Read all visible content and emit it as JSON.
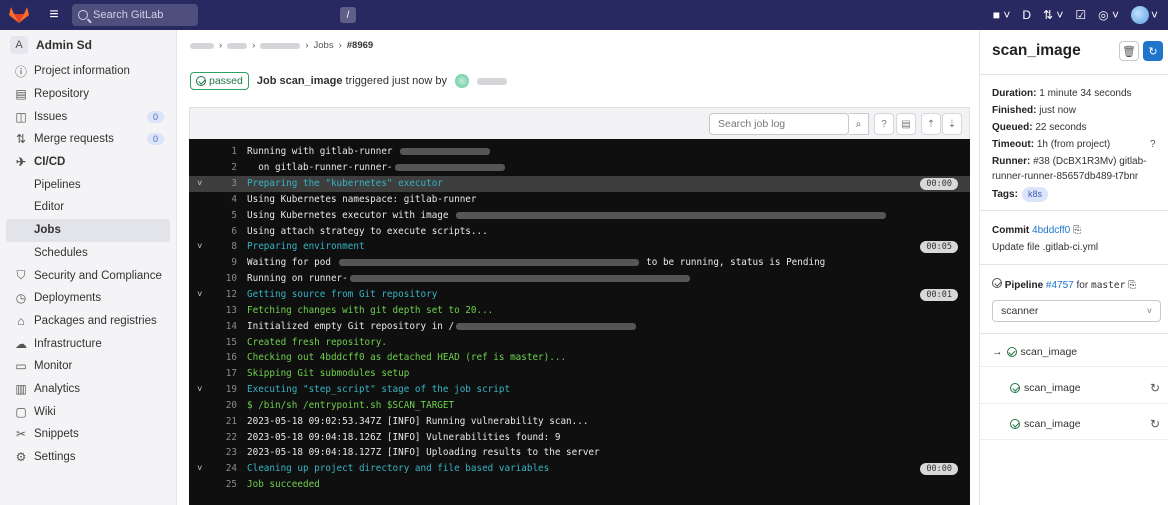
{
  "topbar": {
    "search_placeholder": "Search GitLab",
    "slash_key": "/"
  },
  "sidebar": {
    "project_letter": "A",
    "project_name": "Admin Sd",
    "items": [
      {
        "label": "Project information",
        "icon": "info-icon"
      },
      {
        "label": "Repository",
        "icon": "book-icon"
      },
      {
        "label": "Issues",
        "icon": "issues-icon",
        "count": "0"
      },
      {
        "label": "Merge requests",
        "icon": "merge-request-icon",
        "count": "0"
      },
      {
        "label": "CI/CD",
        "icon": "rocket-icon"
      },
      {
        "label": "Security and Compliance",
        "icon": "shield-icon"
      },
      {
        "label": "Deployments",
        "icon": "deployments-icon"
      },
      {
        "label": "Packages and registries",
        "icon": "package-icon"
      },
      {
        "label": "Infrastructure",
        "icon": "cloud-icon"
      },
      {
        "label": "Monitor",
        "icon": "monitor-icon"
      },
      {
        "label": "Analytics",
        "icon": "chart-icon"
      },
      {
        "label": "Wiki",
        "icon": "wiki-icon"
      },
      {
        "label": "Snippets",
        "icon": "snippet-icon"
      },
      {
        "label": "Settings",
        "icon": "gear-icon"
      }
    ],
    "cicd_sub": [
      "Pipelines",
      "Editor",
      "Jobs",
      "Schedules"
    ]
  },
  "breadcrumb": {
    "jobs": "Jobs",
    "current": "#8969"
  },
  "job_header": {
    "status": "passed",
    "prefix": "Job",
    "job_name": "scan_image",
    "suffix": "triggered just now by"
  },
  "log_toolbar": {
    "search_placeholder": "Search job log"
  },
  "log_lines": [
    {
      "n": "1",
      "text": "Running with gitlab-runner ",
      "cls": "",
      "blur": 90
    },
    {
      "n": "2",
      "text": "  on gitlab-runner-runner-",
      "cls": "",
      "blur": 110
    },
    {
      "n": "3",
      "text": "Preparing the \"kubernetes\" executor",
      "cls": "section hl",
      "chev": true,
      "dur": "00:00"
    },
    {
      "n": "4",
      "text": "Using Kubernetes namespace: gitlab-runner",
      "cls": ""
    },
    {
      "n": "5",
      "text": "Using Kubernetes executor with image ",
      "cls": "",
      "blur": 430
    },
    {
      "n": "6",
      "text": "Using attach strategy to execute scripts...",
      "cls": ""
    },
    {
      "n": "8",
      "text": "Preparing environment",
      "cls": "section",
      "chev": true,
      "dur": "00:05"
    },
    {
      "n": "9",
      "text": "Waiting for pod ",
      "cls": "",
      "blur": 300,
      "after": " to be running, status is Pending"
    },
    {
      "n": "10",
      "text": "Running on runner-",
      "cls": "",
      "blur": 340
    },
    {
      "n": "12",
      "text": "Getting source from Git repository",
      "cls": "section",
      "chev": true,
      "dur": "00:01"
    },
    {
      "n": "13",
      "text": "Fetching changes with git depth set to 20...",
      "cls": "green"
    },
    {
      "n": "14",
      "text": "Initialized empty Git repository in /",
      "cls": "",
      "blur": 180
    },
    {
      "n": "15",
      "text": "Created fresh repository.",
      "cls": "green"
    },
    {
      "n": "16",
      "text": "Checking out 4bddcff0 as detached HEAD (ref is master)...",
      "cls": "green"
    },
    {
      "n": "17",
      "text": "Skipping Git submodules setup",
      "cls": "green"
    },
    {
      "n": "19",
      "text": "Executing \"step_script\" stage of the job script",
      "cls": "section",
      "chev": true
    },
    {
      "n": "20",
      "text": "$ /bin/sh /entrypoint.sh $SCAN_TARGET",
      "cls": "green"
    },
    {
      "n": "21",
      "text": "2023-05-18 09:02:53.347Z [INFO] Running vulnerability scan...",
      "cls": ""
    },
    {
      "n": "22",
      "text": "2023-05-18 09:04:18.126Z [INFO] Vulnerabilities found: 9",
      "cls": ""
    },
    {
      "n": "23",
      "text": "2023-05-18 09:04:18.127Z [INFO] Uploading results to the server",
      "cls": ""
    },
    {
      "n": "24",
      "text": "Cleaning up project directory and file based variables",
      "cls": "section",
      "chev": true,
      "dur": "00:00"
    },
    {
      "n": "25",
      "text": "Job succeeded",
      "cls": "green"
    }
  ],
  "right_panel": {
    "title": "scan_image",
    "duration_label": "Duration:",
    "duration": "1 minute 34 seconds",
    "finished_label": "Finished:",
    "finished": "just now",
    "queued_label": "Queued:",
    "queued": "22 seconds",
    "timeout_label": "Timeout:",
    "timeout": "1h (from project)",
    "runner_label": "Runner:",
    "runner_line1": "#38 (DcBX1R3Mv) gitlab-",
    "runner_line2": "runner-runner-85657db489-t7bnr",
    "tags_label": "Tags:",
    "tag": "k8s",
    "commit_label": "Commit",
    "commit_sha": "4bddcff0",
    "commit_msg": "Update file .gitlab-ci.yml",
    "pipeline_label": "Pipeline",
    "pipeline_id": "#4757",
    "pipeline_for": "for",
    "pipeline_ref": "master",
    "stage": "scanner",
    "jobs": [
      "scan_image",
      "scan_image",
      "scan_image"
    ]
  }
}
